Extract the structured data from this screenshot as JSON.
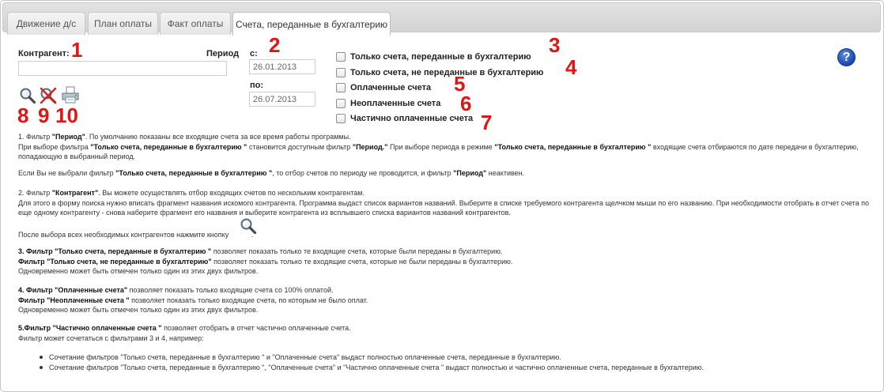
{
  "tabs": [
    {
      "label": "Движение д/с"
    },
    {
      "label": "План оплаты"
    },
    {
      "label": "Факт оплаты"
    },
    {
      "label": "Счета, переданные в бухгалтерию"
    }
  ],
  "active_tab": 3,
  "filters": {
    "contractor_label": "Контрагент:",
    "contractor_value": "",
    "period_label": "Период",
    "from_label": "с:",
    "from_value": "26.01.2013",
    "to_label": "по:",
    "to_value": "26.07.2013",
    "checkboxes": [
      {
        "label": "Только счета, переданные в бухгалтерию",
        "checked": false
      },
      {
        "label": "Только счета, не переданные в бухгалтерию",
        "checked": false
      },
      {
        "label": "Оплаченные счета",
        "checked": false
      },
      {
        "label": "Неоплаченные счета",
        "checked": false
      },
      {
        "label": "Частично оплаченные счета",
        "checked": false
      }
    ]
  },
  "toolbar": {
    "search_icon": "search-icon",
    "clear_icon": "clear-filter-icon",
    "print_icon": "print-icon"
  },
  "help": {
    "label": "?"
  },
  "annotations": {
    "n1": "1",
    "n2": "2",
    "n3": "3",
    "n4": "4",
    "n5": "5",
    "n6": "6",
    "n7": "7",
    "n8": "8",
    "n9": "9",
    "n10": "10"
  },
  "help_text": {
    "p1a_1": "1. Фильтр ",
    "p1a_b1": "\"Период\"",
    "p1a_2": ". По умолчанию показаны все входящие счета за все время работы программы.",
    "p1b_1": "При выборе фильтра ",
    "p1b_b1": "\"Только счета, переданные в бухгалтерию \"",
    "p1b_2": " становится доступным фильтр ",
    "p1b_b2": "\"Период.\"",
    "p1b_3": " При выборе периода в режиме ",
    "p1b_b3": "\"Только счета, переданные в бухгалтерию \"",
    "p1b_4": " входящие счета отбираются по дате передачи в бухгалтерию, попадающую в выбранный период.",
    "p1c_1": "Если Вы не выбрали фильтр ",
    "p1c_b1": "\"Только счета, переданные в бухгалтерию \"",
    "p1c_2": ", то отбор счетов по периоду не проводится, и фильтр ",
    "p1c_b2": "\"Период\"",
    "p1c_3": " неактивен.",
    "p2a_1": "2. Фильтр ",
    "p2a_b1": "\"Контрагент\"",
    "p2a_2": ". Вы можете осуществлять отбор входящих счетов по нескольким контрагентам.",
    "p2b": "Для этого в форму поиска нужно вписать фрагмент названия искомого контрагента. Программа выдаст список вариантов названий. Выберите в списке требуемого контрагента щелчком мыши по его названию. При необходимости отобрать в отчет счета по еще одному контрагенту - снова наберите фрагмент его названия и выберите контрагента из всплывшего списка вариантов названий контрагентов.",
    "p2c_1": "После выбора всех необходимых контрагентов нажмите кнопку ",
    "p2c_2": ".",
    "p3a_b1": "3. Фильтр \"Только счета, переданные в бухгалтерию \"",
    "p3a_2": " позволяет показать только те входящие счета, которые были переданы в бухгалтерию.",
    "p3b_b1": "Фильтр \"Только счета, не переданные в бухгалтерию\"",
    "p3b_2": " позволяет показать только те входящие счета, которые не были переданы в бухгалтерию.",
    "p3c": "Одновременно может быть отмечен только один из этих двух фильтров.",
    "p4a_b1": "4. Фильтр \"Оплаченные счета\"",
    "p4a_2": " позволяет показать только входящие счета со 100% оплатой.",
    "p4b_b1": "Фильтр \"Неоплаченные счета \"",
    "p4b_2": " позволяет показать только входящие счета, по которым не было оплат.",
    "p4c": "Одновременно может быть отмечен только один из этих двух фильтров.",
    "p5a_b1": "5.Фильтр \"Частично оплаченные счета \"",
    "p5a_2": " позволяет отобрать в отчет частично оплаченные счета.",
    "p5b": "Фильтр может сочетаться с фильтрами 3 и 4, например:",
    "bullets": [
      "Сочетание фильтров \"Только счета, переданные в бухгалтерию \" и \"Оплаченные счета\" выдаст полностью оплаченные счета, переданные в бухгалтерию.",
      "Сочетание фильтров \"Только счета, переданные в бухгалтерию \", \"Оплаченные счета\" и \"Частично оплаченные счета \" выдаст полностью и частично оплаченные счета, переданные в бухгалтерию."
    ]
  }
}
